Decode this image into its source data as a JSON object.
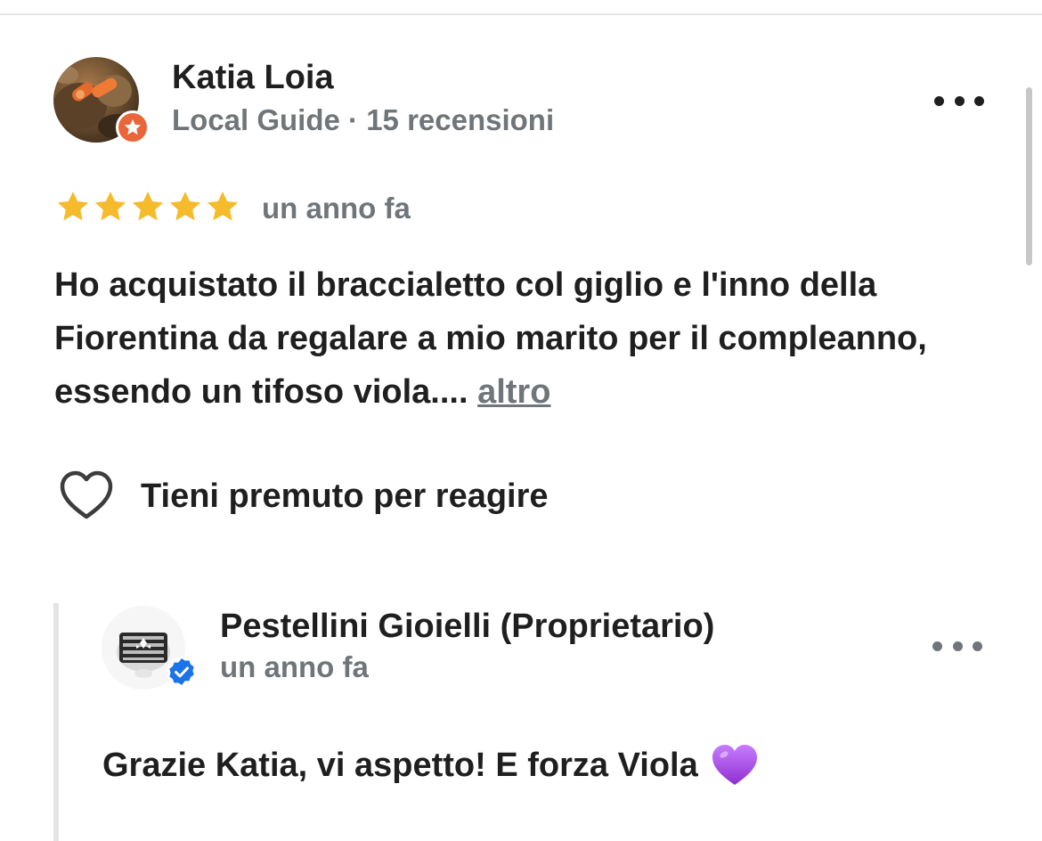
{
  "review": {
    "reviewer_name": "Katia Loia",
    "reviewer_meta": "Local Guide · 15 recensioni",
    "rating": 5,
    "rating_max": 5,
    "time": "un anno fa",
    "text": "Ho acquistato il braccialetto col giglio e l'inno della Fiorentina da regalare a mio marito per il compleanno, essendo un tifoso viola.... ",
    "more_label": "altro",
    "react_label": "Tieni premuto per reagire"
  },
  "reply": {
    "owner_name": "Pestellini Gioielli (Proprietario)",
    "time": "un anno fa",
    "text": "Grazie Katia, vi aspetto! E forza Viola"
  },
  "colors": {
    "star": "#f6bb2c",
    "guide_badge": "#e8663a",
    "verified": "#1a73e8",
    "secondary_text": "#70757a",
    "purple_heart": "#a24bd8"
  },
  "icons": {
    "more": "more-horizontal-icon",
    "star": "star-icon",
    "guide": "local-guide-star-icon",
    "heart": "heart-outline-icon",
    "verified": "verified-check-icon",
    "purple_heart": "purple-heart-emoji"
  }
}
